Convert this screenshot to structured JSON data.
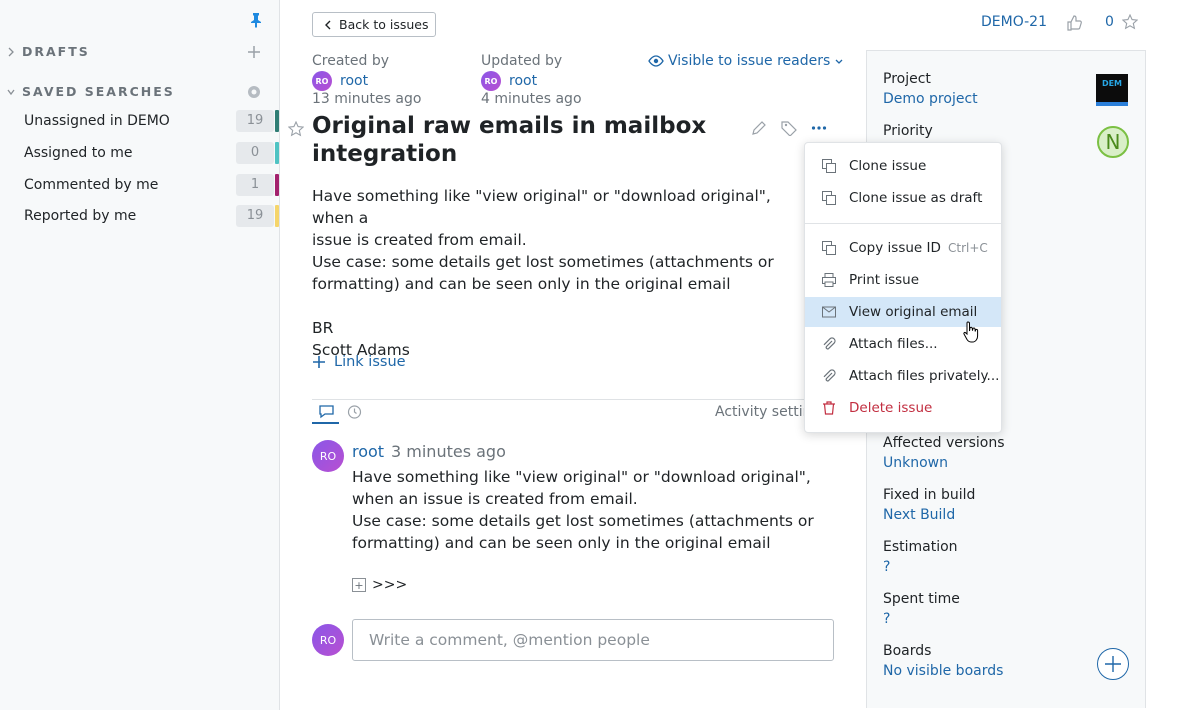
{
  "sidebar": {
    "drafts_title": "DRAFTS",
    "saved_searches_title": "SAVED SEARCHES",
    "saved_searches": [
      {
        "label": "Unassigned in DEMO",
        "count": "19",
        "color": "#2f7d74"
      },
      {
        "label": "Assigned to me",
        "count": "0",
        "color": "#4fc3c3"
      },
      {
        "label": "Commented by me",
        "count": "1",
        "color": "#a3216d"
      },
      {
        "label": "Reported by me",
        "count": "19",
        "color": "#f5d56b"
      }
    ]
  },
  "header": {
    "back_label": "Back to issues",
    "issue_id": "DEMO-21",
    "votes": "0"
  },
  "meta": {
    "created_label": "Created by",
    "created_user": "root",
    "created_time": "13 minutes ago",
    "updated_label": "Updated by",
    "updated_user": "root",
    "updated_time": "4 minutes ago",
    "avatar_initials": "RO",
    "visibility": "Visible to issue readers"
  },
  "issue": {
    "title": "Original raw emails in mailbox integration",
    "description_lines": [
      "Have something like \"view original\" or \"download original\", when a",
      "issue is created from email.",
      "Use case: some details get lost sometimes (attachments or",
      "formatting) and can be seen only in the original email",
      "",
      "BR",
      "Scott Adams"
    ],
    "link_issue_label": "Link issue"
  },
  "activity": {
    "settings_label": "Activity settings",
    "comment": {
      "author": "root",
      "time": "3 minutes ago",
      "lines": [
        "Have something like \"view original\" or \"download original\",",
        "when an issue is created from email.",
        "Use case: some details get lost sometimes (attachments or",
        "formatting) and can be seen only in the original email"
      ],
      "quote_toggle": ">>>"
    },
    "comment_placeholder": "Write a comment, @mention people"
  },
  "menu": {
    "items": [
      {
        "label": "Clone issue",
        "icon": "clone-icon"
      },
      {
        "label": "Clone issue as draft",
        "icon": "clone-icon"
      },
      {
        "label": "Copy issue ID",
        "hint": "Ctrl+C",
        "icon": "copy-icon"
      },
      {
        "label": "Print issue",
        "icon": "print-icon"
      },
      {
        "label": "View original email",
        "icon": "mail-icon",
        "active": true
      },
      {
        "label": "Attach files...",
        "icon": "paperclip-icon"
      },
      {
        "label": "Attach files privately...",
        "icon": "paperclip-icon"
      },
      {
        "label": "Delete issue",
        "icon": "trash-icon",
        "danger": true
      }
    ]
  },
  "fields": {
    "project_label": "Project",
    "project_value": "Demo project",
    "project_logo_text": "DEM",
    "priority_label": "Priority",
    "priority_letter": "N",
    "affected_label": "Affected versions",
    "affected_value": "Unknown",
    "fixed_label": "Fixed in build",
    "fixed_value": "Next Build",
    "estimation_label": "Estimation",
    "estimation_value": "?",
    "spent_label": "Spent time",
    "spent_value": "?",
    "boards_label": "Boards",
    "boards_value": "No visible boards"
  },
  "colors": {
    "accent": "#1f67a8",
    "danger": "#c22e40",
    "menu_highlight": "#d4e7f8"
  }
}
